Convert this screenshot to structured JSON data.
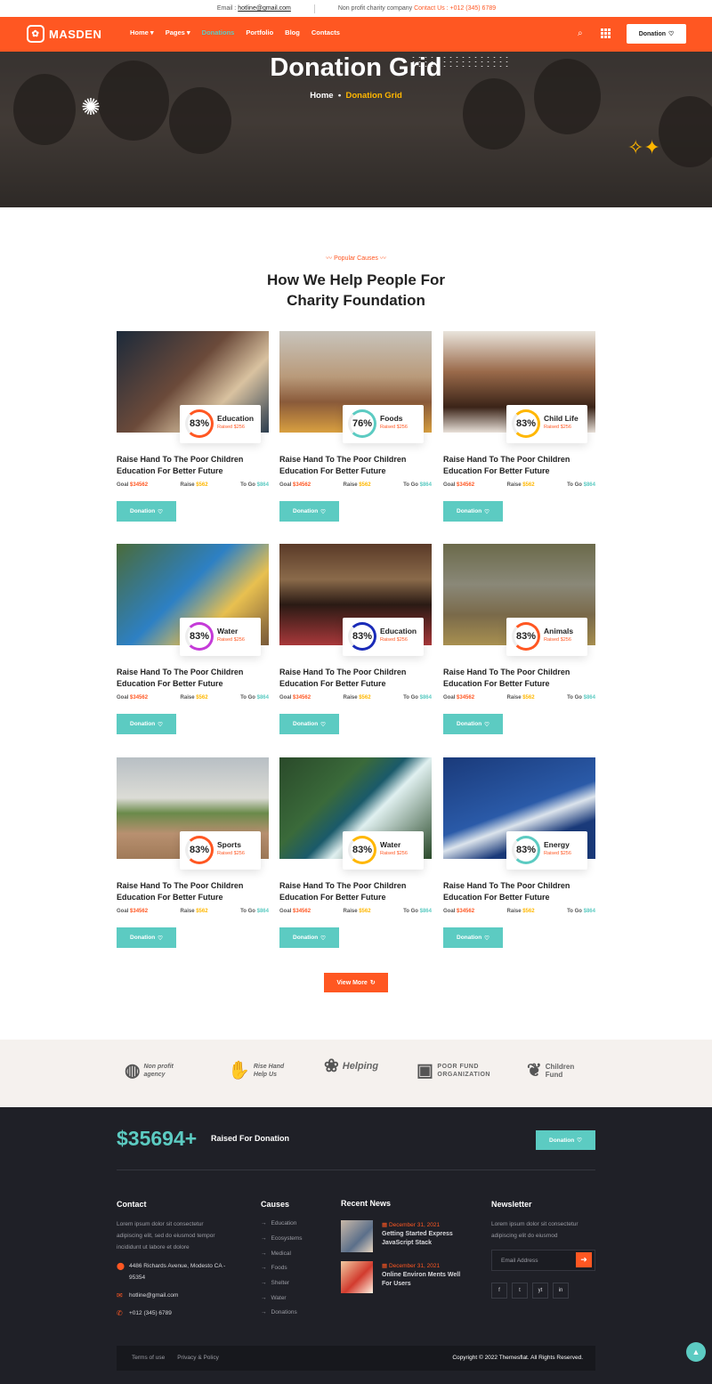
{
  "topbar": {
    "email_label": "Email :",
    "email": "hotline@gmail.com",
    "tagline": "Non profit charity company",
    "contact_label": "Contact Us :",
    "phone": "+012 (345) 6789"
  },
  "brand": {
    "name": "MASDEN",
    "accent": "#ff5722",
    "teal": "#5ccbc2",
    "yellow": "#ffb700"
  },
  "nav": {
    "items": [
      "Home",
      "Pages",
      "Donations",
      "Portfolio",
      "Blog",
      "Contacts"
    ],
    "active": "Donations",
    "donate_label": "Donation"
  },
  "hero": {
    "title": "Donation Grid",
    "breadcrumb_home": "Home",
    "breadcrumb_current": "Donation Grid"
  },
  "section": {
    "subtitle": "Popular Causes",
    "title": "How We Help People For Charity Foundation"
  },
  "causes": [
    {
      "percent": "83%",
      "category": "Education",
      "raised": "Raised $256",
      "ring": "#ff5722",
      "title": "Raise Hand To The Poor Children Education For Better Future",
      "goal_label": "Goal",
      "goal": "$34562",
      "raise_label": "Raise",
      "raise": "$562",
      "togo_label": "To Go",
      "togo": "$864",
      "button": "Donation"
    },
    {
      "percent": "76%",
      "category": "Foods",
      "raised": "Raised $256",
      "ring": "#5ccbc2",
      "title": "Raise Hand To The Poor Children Education For Better Future",
      "goal_label": "Goal",
      "goal": "$34562",
      "raise_label": "Raise",
      "raise": "$562",
      "togo_label": "To Go",
      "togo": "$864",
      "button": "Donation"
    },
    {
      "percent": "83%",
      "category": "Child Life",
      "raised": "Raised $256",
      "ring": "#ffb700",
      "title": "Raise Hand To The Poor Children Education For Better Future",
      "goal_label": "Goal",
      "goal": "$34562",
      "raise_label": "Raise",
      "raise": "$562",
      "togo_label": "To Go",
      "togo": "$864",
      "button": "Donation"
    },
    {
      "percent": "83%",
      "category": "Water",
      "raised": "Raised $256",
      "ring": "#c53bd8",
      "title": "Raise Hand To The Poor Children Education For Better Future",
      "goal_label": "Goal",
      "goal": "$34562",
      "raise_label": "Raise",
      "raise": "$562",
      "togo_label": "To Go",
      "togo": "$864",
      "button": "Donation"
    },
    {
      "percent": "83%",
      "category": "Education",
      "raised": "Raised $256",
      "ring": "#1a2bb8",
      "title": "Raise Hand To The Poor Children Education For Better Future",
      "goal_label": "Goal",
      "goal": "$34562",
      "raise_label": "Raise",
      "raise": "$562",
      "togo_label": "To Go",
      "togo": "$864",
      "button": "Donation"
    },
    {
      "percent": "83%",
      "category": "Animals",
      "raised": "Raised $256",
      "ring": "#ff5722",
      "title": "Raise Hand To The Poor Children Education For Better Future",
      "goal_label": "Goal",
      "goal": "$34562",
      "raise_label": "Raise",
      "raise": "$562",
      "togo_label": "To Go",
      "togo": "$864",
      "button": "Donation"
    },
    {
      "percent": "83%",
      "category": "Sports",
      "raised": "Raised $256",
      "ring": "#ff5722",
      "title": "Raise Hand To The Poor Children Education For Better Future",
      "goal_label": "Goal",
      "goal": "$34562",
      "raise_label": "Raise",
      "raise": "$562",
      "togo_label": "To Go",
      "togo": "$864",
      "button": "Donation"
    },
    {
      "percent": "83%",
      "category": "Water",
      "raised": "Raised $256",
      "ring": "#ffb700",
      "title": "Raise Hand To The Poor Children Education For Better Future",
      "goal_label": "Goal",
      "goal": "$34562",
      "raise_label": "Raise",
      "raise": "$562",
      "togo_label": "To Go",
      "togo": "$864",
      "button": "Donation"
    },
    {
      "percent": "83%",
      "category": "Energy",
      "raised": "Raised $256",
      "ring": "#5ccbc2",
      "title": "Raise Hand To The Poor Children Education For Better Future",
      "goal_label": "Goal",
      "goal": "$34562",
      "raise_label": "Raise",
      "raise": "$562",
      "togo_label": "To Go",
      "togo": "$864",
      "button": "Donation"
    }
  ],
  "view_more": "View More",
  "partners": [
    {
      "line1": "Non profit",
      "line2": "agency",
      "icon": "globe-icon"
    },
    {
      "line1": "Rise Hand",
      "line2": "Help Us",
      "icon": "hands-icon"
    },
    {
      "line1": "Helping",
      "line2": "",
      "icon": "lotus-icon"
    },
    {
      "line1": "POOR FUND",
      "line2": "ORGANIZATION",
      "icon": "frame-icon"
    },
    {
      "line1": "Children",
      "line2": "Fund",
      "icon": "tree-icon"
    }
  ],
  "footer": {
    "raised_amount": "$35694+",
    "raised_label": "Raised For Donation",
    "donate_label": "Donation",
    "contact": {
      "heading": "Contact",
      "text": "Lorem ipsum dolor sit consectetur adipiscing elit, sed do eiusmod tempor incididunt ut labore et dolore",
      "address": "4486 Richards Avenue, Modesto CA - 95354",
      "email": "hotline@gmail.com",
      "phone": "+012 (345) 6789"
    },
    "causes": {
      "heading": "Causes",
      "items": [
        "Education",
        "Ecosystems",
        "Medical",
        "Foods",
        "Shelter",
        "Water",
        "Donations"
      ]
    },
    "news": {
      "heading": "Recent News",
      "items": [
        {
          "date": "December 31, 2021",
          "title": "Getting Started Express JavaScript Stack"
        },
        {
          "date": "December 31, 2021",
          "title": "Online Environ Ments Well For Users"
        }
      ]
    },
    "newsletter": {
      "heading": "Newsletter",
      "text": "Lorem ipsum dolor sit consectetur adipiscing elit do eiusmod",
      "placeholder": "Email Address",
      "social": [
        "f",
        "t",
        "yt",
        "in"
      ]
    },
    "bottom": {
      "terms": "Terms of use",
      "privacy": "Privacy & Policy",
      "copyright": "Copyright © 2022 Themesflat. All Rights Reserved."
    }
  }
}
